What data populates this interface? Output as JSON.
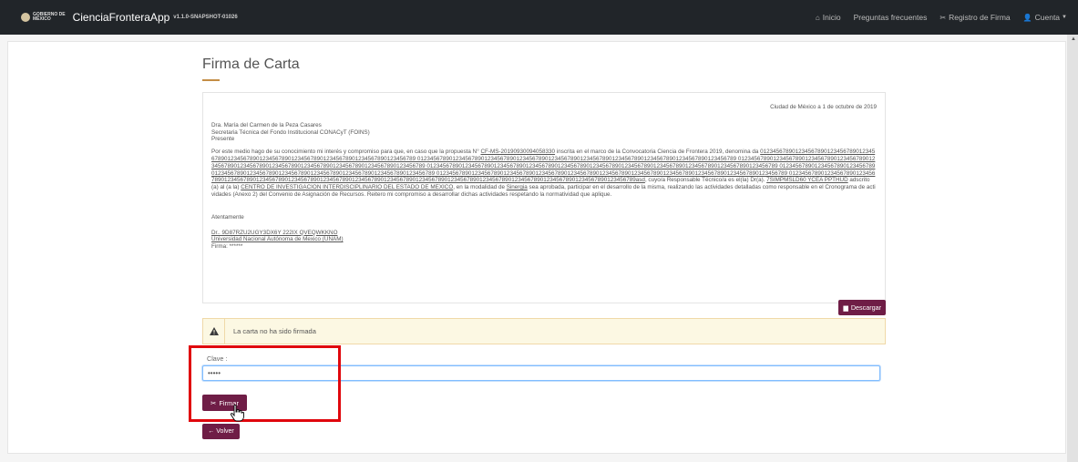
{
  "header": {
    "gov_logo_line1": "GOBIERNO DE",
    "gov_logo_line2": "MÉXICO",
    "app_name": "CienciaFronteraApp",
    "app_version": "v1.1.0-SNAPSHOT-01026",
    "nav": [
      {
        "icon": "home-icon",
        "glyph": "⌂",
        "label": "Inicio"
      },
      {
        "label": "Preguntas frecuentes"
      },
      {
        "icon": "signature-icon",
        "glyph": "✂",
        "label": "Registro de Firma"
      },
      {
        "icon": "user-icon",
        "glyph": "👤",
        "label": "Cuenta"
      }
    ]
  },
  "page": {
    "title": "Firma de Carta",
    "accent_color": "#c48d45"
  },
  "letter": {
    "date_line": "Ciudad de México a 1 de octubre de 2019",
    "recipient_name": "Dra. María del Carmen de la Peza Casares",
    "recipient_role": "Secretaria Técnica del Fondo Institucional CONACyT (FOINS)",
    "recipient_presente": "Presente",
    "body_intro": "Por este medio hago de su conocimiento mi interés y compromiso para que, en caso que la propuesta N° ",
    "proposal_number": "CF-MS-20190930094058330",
    "body_mid1": " inscrita en el marco de la Convocatoria Ciencia de Frontera 2019, denomina da ",
    "proposal_name": "0123456789012345678901234567890123456789012345678901234567890123456789012345678901234567890123456789 0123456789012345678901234567890123456789012345678901234567890123456789012345678901234567890123456789 01234567890123456789012345678901234567890123456789012345678901234567890123456789012345678901234567890123456789 01234567890123456789012345678901234567890123456789012345678901234567890123456789012345678901234567890123456789 0123456789012345678901234567890123456789012345678901234567890123456789012345678901234567890123456789 01234567890123456789012345678901234567890123456789012345678901234567890123456789012345678901234567890123456789 0123456789012345678901234567890123456789012345678901234567890123456789012345678901234567890123456789012345678901234567890123456789012345678901234567890123456789asd",
    "body_mid2": ", cuyo/a Responsable Técnico/a es el(la) Dr(a). ",
    "responsable": "7SIMPMSLD60 YCEA PPTHUD",
    "body_mid3": " adscrito(a) al (a la) ",
    "institution": "CENTRO DE INVESTIGACION INTERDISCIPLINARIO DEL ESTADO DE MEXICO",
    "body_mid4": ", en la modalidad de ",
    "modality": "Sinergia",
    "body_end": " sea aprobada, participar en el desarrollo de la misma, realizando las actividades detalladas como responsable en el Cronograma de actividades (Anexo 2) del Convenio de Asignación de Recursos. Reitero mi compromiso a desarrollar dichas actividades respetando la normatividad que aplique.",
    "closing": "Atentamente",
    "signer_name": "Dr.. 9D87RZU2UGY3DX6Y 222IX QVEQWKKNO",
    "signer_institution": "Universidad Nacional Autónoma de Mexico (UNAM)",
    "signature_line": "Firma: ******"
  },
  "actions": {
    "download_label": "Descargar",
    "download_icon": "file-icon",
    "sign_label": "Firmar",
    "sign_icon": "signature-icon",
    "back_label": "Volver",
    "back_icon": "arrow-left-icon"
  },
  "alert": {
    "icon": "warning-icon",
    "message": "La carta no ha sido firmada"
  },
  "form": {
    "key_label": "Clave :",
    "key_value": "•••••"
  },
  "colors": {
    "primary": "#6f1d46",
    "navbar": "#212529",
    "highlight": "#e0070d",
    "alert_bg": "#fcf8e3"
  }
}
